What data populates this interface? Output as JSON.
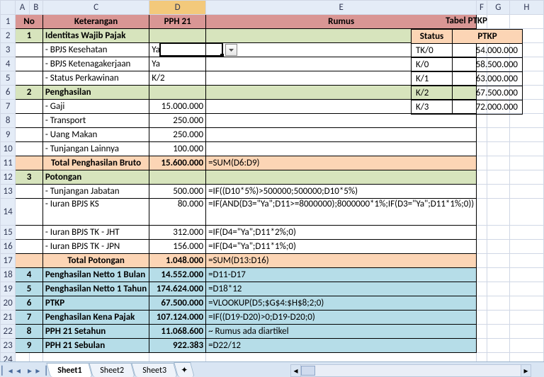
{
  "columns": {
    "corner": "",
    "A": "A",
    "B": "B",
    "C": "C",
    "D": "D",
    "E": "E",
    "F": "F",
    "G": "G",
    "H": "H"
  },
  "header": {
    "no": "No",
    "ket": "Keterangan",
    "pph": "PPH 21",
    "rumus": "Rumus"
  },
  "rows": {
    "r2": {
      "no": "1",
      "ket": "Identitas Wajib Pajak"
    },
    "r3": {
      "ket": "- BPJS Kesehatan",
      "val": "Ya"
    },
    "r4": {
      "ket": "- BPJS Ketenagakerjaan",
      "val": "Ya"
    },
    "r5": {
      "ket": "- Status Perkawinan",
      "val": "K/2"
    },
    "r6": {
      "no": "2",
      "ket": "Penghasilan"
    },
    "r7": {
      "ket": "- Gaji",
      "val": "15.000.000"
    },
    "r8": {
      "ket": "- Transport",
      "val": "250.000"
    },
    "r9": {
      "ket": "- Uang Makan",
      "val": "250.000"
    },
    "r10": {
      "ket": "- Tunjangan Lainnya",
      "val": "100.000"
    },
    "r11": {
      "ket": "Total Penghasilan Bruto",
      "val": "15.600.000",
      "rumus": "=SUM(D6:D9)"
    },
    "r12": {
      "no": "3",
      "ket": "Potongan"
    },
    "r13": {
      "ket": "- Tunjangan Jabatan",
      "val": "500.000",
      "rumus": "=IF((D10*5%)>500000;500000;D10*5%)"
    },
    "r14": {
      "ket": "- Iuran BPJS KS",
      "val": "80.000",
      "rumus": "=IF(AND(D3=\"Ya\";D11>=8000000);8000000*1%;IF(D3=\"Ya\";D11*1%;0))"
    },
    "r15": {
      "ket": "- Iuran BPJS TK - JHT",
      "val": "312.000",
      "rumus": "=IF(D4=\"Ya\";D11*2%;0)"
    },
    "r16": {
      "ket": "- Iuran BPJS TK - JPN",
      "val": "156.000",
      "rumus": "=IF(D4=\"Ya\";D11*1%;0)"
    },
    "r17": {
      "ket": "Total Potongan",
      "val": "1.048.000",
      "rumus": "=SUM(D13:D16)"
    },
    "r18": {
      "no": "4",
      "ket": "Penghasilan Netto 1 Bulan",
      "val": "14.552.000",
      "rumus": "=D11-D17"
    },
    "r19": {
      "no": "5",
      "ket": "Penghasilan Netto 1 Tahun",
      "val": "174.624.000",
      "rumus": "=D18*12"
    },
    "r20": {
      "no": "6",
      "ket": "PTKP",
      "val": "67.500.000",
      "rumus": "=VLOOKUP(D5;$G$4:$H$8;2;0)"
    },
    "r21": {
      "no": "7",
      "ket": "Penghasilan Kena Pajak",
      "val": "107.124.000",
      "rumus": "=IF((D19-D20)>0;D19-D20;0)"
    },
    "r22": {
      "no": "8",
      "ket": "PPH 21 Setahun",
      "val": "11.068.600",
      "rumus": "~ Rumus ada diartikel"
    },
    "r23": {
      "no": "9",
      "ket": "PPH 21 Sebulan",
      "val": "922.383",
      "rumus": "=D22/12"
    }
  },
  "ptkp": {
    "title": "Tabel PTKP",
    "h1": "Status",
    "h2": "PTKP",
    "rows": [
      {
        "s": "TK/0",
        "v": "54.000.000"
      },
      {
        "s": "K/0",
        "v": "58.500.000"
      },
      {
        "s": "K/1",
        "v": "63.000.000"
      },
      {
        "s": "K/2",
        "v": "67.500.000"
      },
      {
        "s": "K/3",
        "v": "72.000.000"
      }
    ]
  },
  "tabs": {
    "s1": "Sheet1",
    "s2": "Sheet2",
    "s3": "Sheet3"
  }
}
